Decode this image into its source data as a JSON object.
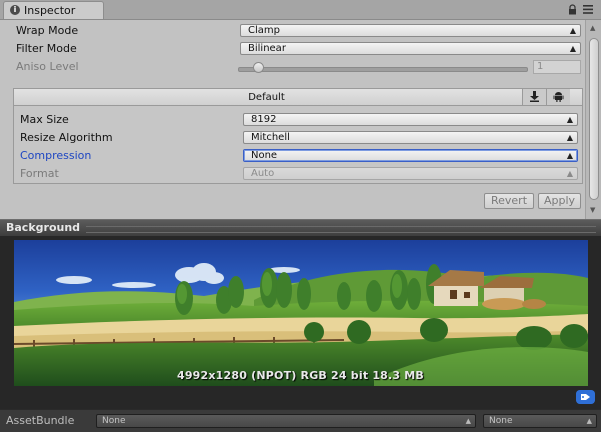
{
  "tab": {
    "label": "Inspector",
    "icon": "info-icon"
  },
  "window_icons": [
    "lock-icon",
    "menu-icon"
  ],
  "settings": {
    "wrap_mode": {
      "label": "Wrap Mode",
      "value": "Clamp"
    },
    "filter_mode": {
      "label": "Filter Mode",
      "value": "Bilinear"
    },
    "aniso_level": {
      "label": "Aniso Level",
      "value": "1",
      "slider_fraction": 0.05
    }
  },
  "platform": {
    "title": "Default",
    "tab_icons": [
      "download-icon",
      "android-icon"
    ],
    "max_size": {
      "label": "Max Size",
      "value": "8192"
    },
    "resize_algorithm": {
      "label": "Resize Algorithm",
      "value": "Mitchell"
    },
    "compression": {
      "label": "Compression",
      "value": "None"
    },
    "format": {
      "label": "Format",
      "value": "Auto"
    }
  },
  "buttons": {
    "revert": "Revert",
    "apply": "Apply"
  },
  "preview": {
    "title": "Background",
    "info": "4992x1280 (NPOT)  RGB 24 bit  18.3 MB"
  },
  "assetbundle": {
    "label": "AssetBundle",
    "name_value": "None",
    "variant_value": "None"
  },
  "colors": {
    "panel_bg": "#c2c2c2",
    "preview_bg": "#272727",
    "label_blue": "#1e46c2"
  }
}
